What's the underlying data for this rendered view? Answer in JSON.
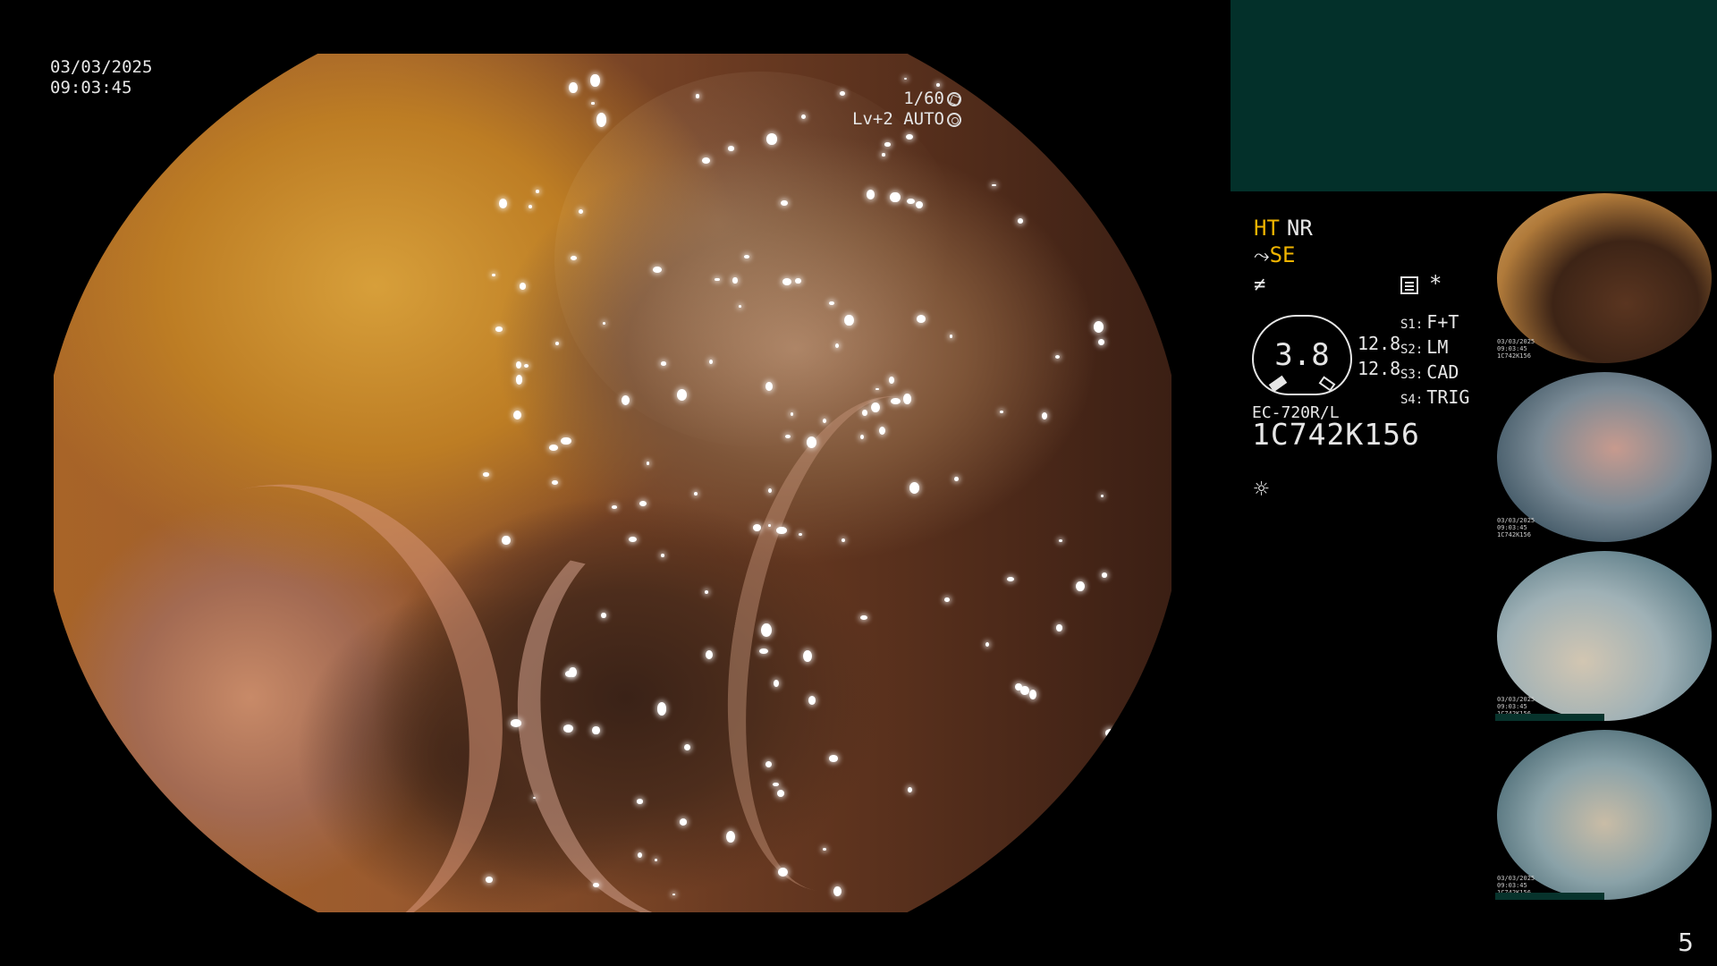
{
  "osd": {
    "date": "03/03/2025",
    "time": "09:03:45",
    "shutter": "1/60",
    "level": "Lv+2 AUTO"
  },
  "status": {
    "ht": "HT",
    "nr": "NR",
    "se": "SE"
  },
  "settings": {
    "items": [
      {
        "key": "S1:",
        "value": "F+T"
      },
      {
        "key": "S2:",
        "value": "LM"
      },
      {
        "key": "S3:",
        "value": "CAD"
      },
      {
        "key": "S4:",
        "value": "TRIG"
      }
    ],
    "asterisk": "*"
  },
  "gauge": {
    "value": "3.8",
    "side_top": "12.8",
    "side_bottom": "12.8"
  },
  "scope": {
    "model": "EC-720R/L",
    "serial": "1C742K156"
  },
  "thumbnails": [
    {
      "label_top": "03/03/2025",
      "label_mid": "09:03:45",
      "serial": "1C742K156"
    },
    {
      "label_top": "03/03/2025",
      "label_mid": "09:03:45",
      "serial": "1C742K156"
    },
    {
      "label_top": "03/03/2025",
      "label_mid": "09:03:45",
      "serial": "1C742K156"
    },
    {
      "label_top": "03/03/2025",
      "label_mid": "09:03:45",
      "serial": "1C742K156"
    }
  ],
  "page_number": "5",
  "colors": {
    "highlight": "#f0b400",
    "panel": "#03302a",
    "text": "#e6e6e6"
  },
  "icons": [
    "aperture-icon",
    "auto-exposure-icon",
    "enhance-icon",
    "freeze-icon",
    "menu-icon",
    "light-icon"
  ]
}
